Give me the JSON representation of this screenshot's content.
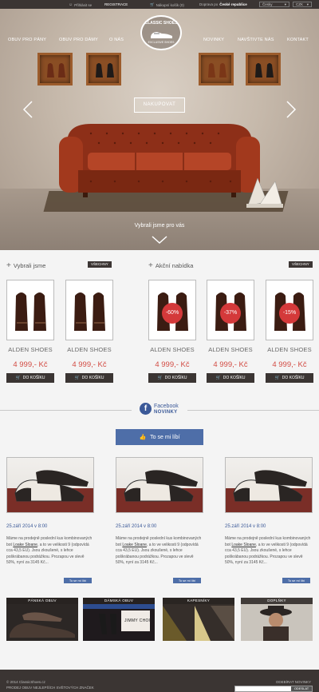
{
  "topbar": {
    "login": "Přihlásit se",
    "register": "REGISTRACE",
    "cart": "Nákupní košík (0)",
    "shipping_prefix": "Doprava po",
    "shipping_country": "České republice",
    "lang": "Česky",
    "currency": "CZK"
  },
  "nav": {
    "left": [
      "OBUV PRO PÁNY",
      "OBUV PRO DÁMY",
      "O NÁS"
    ],
    "right": [
      "NOVINKY",
      "NAVŠTIVTE NÁS",
      "KONTAKT"
    ]
  },
  "logo": {
    "top": "CLASSIC SHOES",
    "bottom": "EXCLUSIVE SHOES"
  },
  "hero": {
    "cta": "NAKUPOVAT",
    "tagline": "Vybrali jsme pro vás"
  },
  "picked": {
    "title": "Vybrali jsme",
    "all_button": "VŠECHNY",
    "products": [
      {
        "name": "ALDEN SHOES",
        "price": "4 999,- Kč",
        "buy": "DO KOŠÍKU"
      },
      {
        "name": "ALDEN SHOES",
        "price": "4 999,- Kč",
        "buy": "DO KOŠÍKU"
      }
    ]
  },
  "offers": {
    "title": "Akční nabídka",
    "all_button": "VŠECHNY",
    "products": [
      {
        "name": "ALDEN SHOES",
        "price": "4 999,- Kč",
        "buy": "DO KOŠÍKU",
        "discount": "-60%"
      },
      {
        "name": "ALDEN SHOES",
        "price": "4 999,- Kč",
        "buy": "DO KOŠÍKU",
        "discount": "-37%"
      },
      {
        "name": "ALDEN SHOES",
        "price": "4 999,- Kč",
        "buy": "DO KOŠÍKU",
        "discount": "-15%"
      }
    ]
  },
  "facebook": {
    "title": "Facebook",
    "subtitle": "NOVINKY",
    "like": "To se mi líbí",
    "posts": [
      {
        "date": "25.září 2014 v 8:00",
        "text_before": "Máme na prodejně poslední kus kombinovaných bot ",
        "link": "Loake Sloane",
        "text_after": ", a to ve velikosti 9 (odpovídá cca 43,5 EU). Jsou zkoušené, s lehce poškrábanou podrážkou. Prozapou ve slevě 50%, nyní za 3145 Kč...",
        "like": "To se mi líbí"
      },
      {
        "date": "25.září 2014 v 8:00",
        "text_before": "Máme na prodejně poslední kus kombinovaných bot ",
        "link": "Loake Sloane",
        "text_after": ", a to ve velikosti 9 (odpovídá cca 43,5 EU). Jsou zkoušené, s lehce poškrábanou podrážkou. Prozapou ve slevě 50%, nyní za 3145 Kč...",
        "like": "To se mi líbí"
      },
      {
        "date": "25.září 2014 v 8:00",
        "text_before": "Máme na prodejně poslední kus kombinovaných bot ",
        "link": "Loake Sloane",
        "text_after": ", a to ve velikosti 9 (odpovídá cca 43,5 EU). Jsou zkoušené, s lehce poškrábanou podrážkou. Prozapou ve slevě 50%, nyní za 3145 Kč...",
        "like": "To se mi líbí"
      }
    ]
  },
  "categories": [
    "PÁNSKÁ OBUV",
    "DÁMSKÁ OBUV",
    "KAPESNÍKY",
    "DOPLŇKY"
  ],
  "category_brand": "JIMMY CHOO",
  "footer": {
    "copyright": "© 2014 ClassicShoes.cz",
    "slogan": "PRODEJ OBUV NEJLEPŠÍCH SVĚTOVÝCH ZNAČEK",
    "newsletter_label": "ODEBÍRAT NOVINKY",
    "newsletter_button": "ODESLAT"
  },
  "colors": {
    "dark": "#3b3533",
    "price": "#d24b43",
    "facebook": "#3b5998",
    "badge": "#d4393a"
  }
}
